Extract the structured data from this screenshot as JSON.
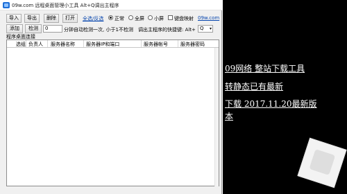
{
  "titlebar": {
    "title": "09w.com 远程桌面管理小工具 Alt+Q调出主程序"
  },
  "toolbar": {
    "import_label": "导入",
    "export_label": "导出",
    "delete_label": "删除",
    "open_label": "打开",
    "select_all_label": "全选/反选",
    "view_modes": [
      {
        "label": "正常",
        "selected": true
      },
      {
        "label": "全屏",
        "selected": false
      },
      {
        "label": "小屏",
        "selected": false
      }
    ],
    "keyboard_map_label": "键盘映射",
    "website_link": "09w.com"
  },
  "secondary_toolbar": {
    "add_label": "添加",
    "check_label": "检测",
    "minutes_value": "0",
    "auto_check_text": "分钟自动检测一次, 小于1不检测",
    "hotkey_label": "调出主程序的快捷键: Alt+",
    "hotkey_key": "Q"
  },
  "table": {
    "group_label": "程序桌面连接",
    "columns": [
      "选组",
      "负责人",
      "服务器名称",
      "服务器IP和端口",
      "服务器帐号",
      "服务器密码"
    ],
    "rows": []
  },
  "panel": {
    "lines": [
      "09网络  整站下载工具",
      "转静态已有最新",
      "下载  2017.11.20最新版",
      "本"
    ]
  }
}
